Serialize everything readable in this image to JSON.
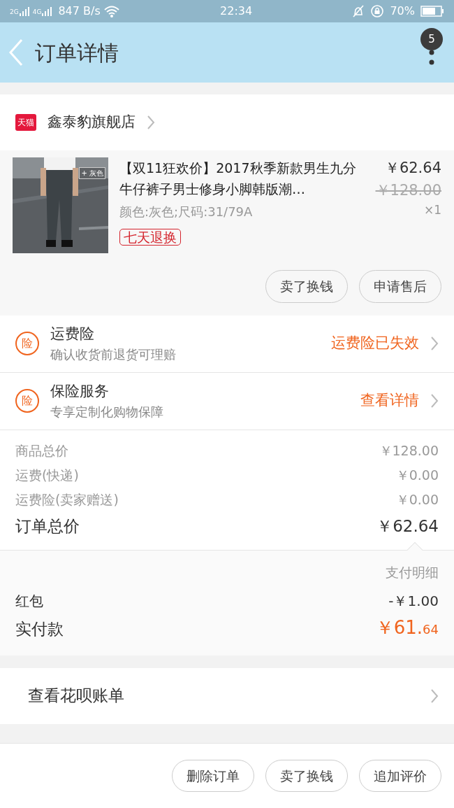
{
  "status_bar": {
    "network_1": "2G",
    "network_2": "4G",
    "speed": "847 B/s",
    "time": "22:34",
    "battery": "70%"
  },
  "header": {
    "title": "订单详情",
    "badge": "5"
  },
  "shop": {
    "logo": "天猫",
    "name": "鑫泰豹旗舰店"
  },
  "product": {
    "title": "【双11狂欢价】2017秋季新款男生九分牛仔裤子男士修身小脚韩版潮…",
    "image_tag": "+ 灰色",
    "specs": "颜色:灰色;尺码:31/79A",
    "tag": "七天退换",
    "price": "￥62.64",
    "original_price": "￥128.00",
    "quantity": "×1",
    "actions": [
      "卖了换钱",
      "申请售后"
    ]
  },
  "services": [
    {
      "icon": "险",
      "title": "运费险",
      "subtitle": "确认收货前退货可理赔",
      "action": "运费险已失效"
    },
    {
      "icon": "险",
      "title": "保险服务",
      "subtitle": "专享定制化购物保障",
      "action": "查看详情"
    }
  ],
  "price_summary": [
    {
      "label": "商品总价",
      "value": "￥128.00",
      "kind": "minor"
    },
    {
      "label": "运费(快递)",
      "value": "￥0.00",
      "kind": "minor"
    },
    {
      "label": "运费险(卖家赠送)",
      "value": "￥0.00",
      "kind": "minor"
    },
    {
      "label": "订单总价",
      "value": "￥62.64",
      "kind": "total"
    }
  ],
  "payment": {
    "detail_label": "支付明细",
    "rows": [
      {
        "label": "红包",
        "value": "-￥1.00"
      }
    ],
    "paid_label": "实付款",
    "paid_main": "￥61.",
    "paid_decimal": "64"
  },
  "bill_link": "查看花呗账单",
  "bottom_actions": [
    "删除订单",
    "卖了换钱",
    "追加评价"
  ]
}
